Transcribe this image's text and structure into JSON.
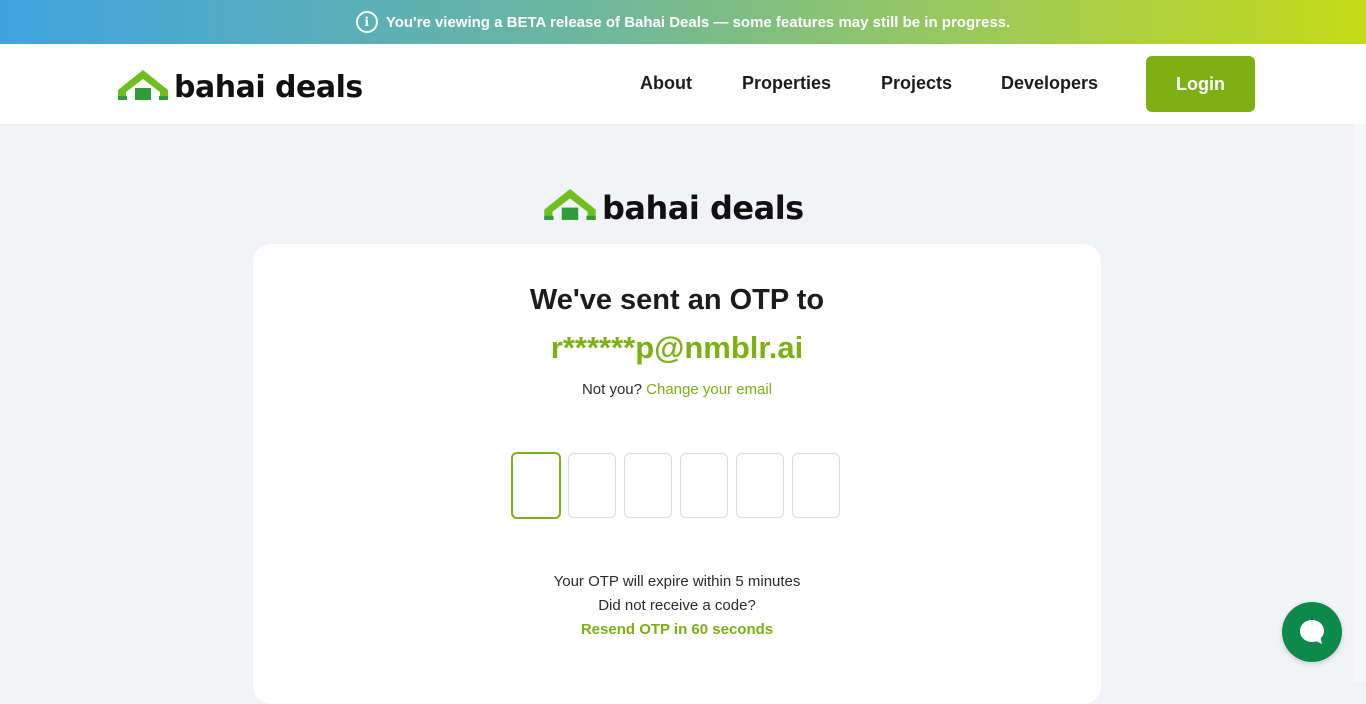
{
  "banner": {
    "info_icon": "info-icon",
    "info_glyph": "i",
    "text": "You're viewing a BETA release of Bahai Deals — some features may still be in progress."
  },
  "header": {
    "logo_text": "bahai deals",
    "nav": [
      {
        "label": "About"
      },
      {
        "label": "Properties"
      },
      {
        "label": "Projects"
      },
      {
        "label": "Developers"
      }
    ],
    "login_label": "Login"
  },
  "main": {
    "logo_text": "bahai deals",
    "title": "We've sent an OTP to",
    "email": "r******p@nmblr.ai",
    "not_you_text": "Not you?",
    "change_email_label": "Change your email",
    "otp_digits": [
      "",
      "",
      "",
      "",
      "",
      ""
    ],
    "expire_text": "Your OTP will expire within 5 minutes",
    "no_code_text": "Did not receive a code?",
    "resend_text": "Resend OTP in 60 seconds"
  },
  "chat": {
    "icon": "chat-bubble-icon"
  },
  "colors": {
    "brand_green": "#7cb013",
    "chat_green": "#0d8a4a",
    "text_dark": "#1c1c1e",
    "page_bg": "#f1f3f7"
  }
}
